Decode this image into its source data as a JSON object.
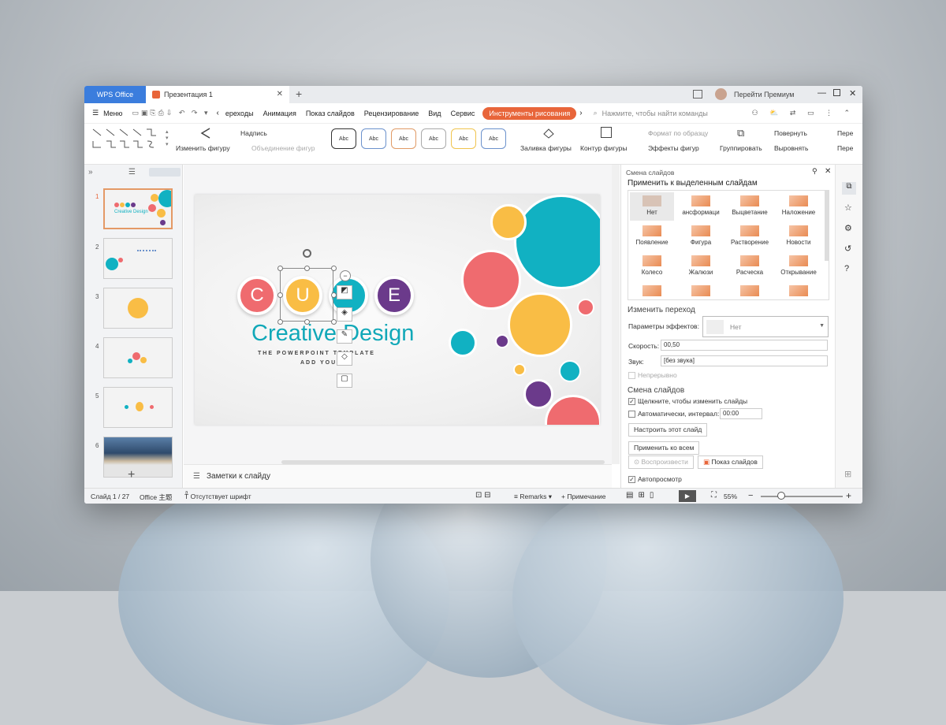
{
  "titlebar": {
    "wps": "WPS Office",
    "doc": "Презентация 1",
    "close": "✕",
    "add": "+",
    "premium": "Перейти Премиум"
  },
  "menu": {
    "menu": "Меню",
    "items": [
      "ереходы",
      "Анимация",
      "Показ слайдов",
      "Рецензирование",
      "Вид",
      "Сервис"
    ],
    "drawing": "Инструменты рисования",
    "search": "Нажмите, чтобы найти команды"
  },
  "ribbon": {
    "change_shape": "Изменить фигуру",
    "label": "Надпись",
    "merge_shape": "Объединение фигур",
    "abc": "Abc",
    "fill": "Заливка фигуры",
    "outline": "Контур фигуры",
    "format_painter": "Формат по образцу",
    "effects": "Эффекты фигур",
    "group": "Группировать",
    "rotate": "Повернуть",
    "align": "Выровнять",
    "move": "Пере",
    "move2": "Пере"
  },
  "slides": {
    "numbers": [
      "1",
      "2",
      "3",
      "4",
      "5",
      "6"
    ]
  },
  "slide": {
    "c": "C",
    "u": "U",
    "e": "E",
    "title1": "Creative",
    "title2": "Design",
    "sub1": "THE  POWERPOINT  TEMPLATE",
    "sub2": "ADD YOUR"
  },
  "notes": {
    "label": "Заметки к слайду"
  },
  "panel": {
    "title": "Смена слайдов",
    "apply_selected": "Применить к выделенным слайдам",
    "transitions": [
      "Нет",
      "ансформаци",
      "Выцветание",
      "Наложение",
      "Появление",
      "Фигура",
      "Растворение",
      "Новости",
      "Колесо",
      "Жалюзи",
      "Расческа",
      "Открывание",
      "",
      "",
      "",
      ""
    ],
    "change_transition": "Изменить переход",
    "effect_params": "Параметры эффектов:",
    "effect_value": "Нет",
    "speed": "Скорость:",
    "speed_value": "00,50",
    "sound": "Звук:",
    "sound_value": "[без звука]",
    "loop": "Непрерывно",
    "slide_change": "Смена слайдов",
    "on_click": "Щелкните, чтобы изменить слайды",
    "auto": "Автоматически, интервал:",
    "auto_value": "00:00",
    "configure": "Настроить этот слайд",
    "apply_all": "Применить ко всем",
    "play": "Воспроизвести",
    "show": "Показ слайдов",
    "preview": "Автопросмотр"
  },
  "status": {
    "slide": "Слайд 1 / 27",
    "theme": "Office 主题",
    "font": "Отсутствует шрифт",
    "remarks": "Remarks",
    "note": "Примечание",
    "zoom": "55%"
  },
  "colors": {
    "accent": "#e8653a",
    "blue": "#3b7ddd",
    "pink": "#ef6b6f",
    "yellow": "#f9bd45",
    "teal": "#11b1c2",
    "purple": "#6b3a8b"
  }
}
